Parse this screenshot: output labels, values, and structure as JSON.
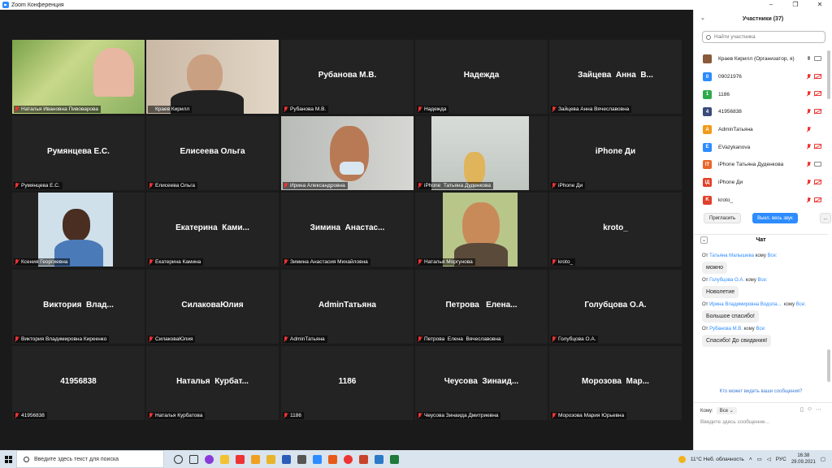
{
  "window": {
    "title": "Zoom Конференция"
  },
  "tiles": [
    {
      "big": "",
      "name": "Наталья Ивановна Пивоварова",
      "photo": "woman-glasses",
      "muted": true
    },
    {
      "big": "",
      "name": "Краев Кирилл",
      "photo": "man-office",
      "active": true,
      "muted": false
    },
    {
      "big": "Рубанова М.В.",
      "name": "Рубанова М.В.",
      "muted": true
    },
    {
      "big": "Надежда",
      "name": "Надежда",
      "muted": true
    },
    {
      "big": "Зайцева  Анна  В...",
      "name": "Зайцева Анна Вячеславовна",
      "muted": true
    },
    {
      "big": "Румянцева Е.С.",
      "name": "Румянцева Е.С.",
      "muted": true
    },
    {
      "big": "Елисеева Ольга",
      "name": "Елисеева Ольга",
      "muted": true
    },
    {
      "big": "",
      "name": "Ирина Александровна",
      "photo": "woman-mask",
      "muted": true
    },
    {
      "big": "",
      "name": "iPhone  Татьяна Дуденкова",
      "photo": "room",
      "muted": true
    },
    {
      "big": "iPhone Ди",
      "name": "iPhone Ди",
      "muted": true
    },
    {
      "big": "",
      "name": "Ксения Георгиевна",
      "photo": "woman-blue",
      "muted": true
    },
    {
      "big": "Екатерина  Ками...",
      "name": "Екатерина Камина",
      "muted": true
    },
    {
      "big": "Зимина  Анастас...",
      "name": "Зимина Анастасия Михайловна",
      "muted": true
    },
    {
      "big": "",
      "name": "Наталья Моргунова",
      "photo": "woman-portrait",
      "muted": true
    },
    {
      "big": "kroto_",
      "name": "kroto_",
      "muted": true
    },
    {
      "big": "Виктория  Влад...",
      "name": "Виктория Владимировна Киреенко",
      "muted": true
    },
    {
      "big": "СилаковаЮлия",
      "name": "СилаковаЮлия",
      "muted": true
    },
    {
      "big": "AdminТатьяна",
      "name": "AdminТатьяна",
      "muted": true
    },
    {
      "big": "Петрова   Елена...",
      "name": "Петрова  Елена  Вячеславовна",
      "muted": true
    },
    {
      "big": "Голубцова О.А.",
      "name": "Голубцова О.А.",
      "muted": true
    },
    {
      "big": "41956838",
      "name": "41956838",
      "muted": true
    },
    {
      "big": "Наталья  Курбат...",
      "name": "Наталья Курбатова",
      "muted": true
    },
    {
      "big": "1186",
      "name": "1186",
      "muted": true
    },
    {
      "big": "Чеусова  Зинаид...",
      "name": "Чеусова Зинаида Дмитриевна",
      "muted": true
    },
    {
      "big": "Морозова  Мар...",
      "name": "Морозова Мария Юрьевна",
      "muted": true
    }
  ],
  "participants_panel": {
    "title": "Участники (37)",
    "search_placeholder": "Найти участника",
    "rows": [
      {
        "avatar": "",
        "avatar_color": "#8a5a3a",
        "name": "Краев Кирилл (Организатор, я)",
        "mic_on": true,
        "cam_on": true
      },
      {
        "avatar": "0",
        "avatar_color": "#2D8CFF",
        "name": "09021976",
        "mic_on": false,
        "cam_on": false
      },
      {
        "avatar": "1",
        "avatar_color": "#2eaa4c",
        "name": "1186",
        "mic_on": false,
        "cam_on": false
      },
      {
        "avatar": "4",
        "avatar_color": "#3a4a7a",
        "name": "41956838",
        "mic_on": false,
        "cam_on": false
      },
      {
        "avatar": "A",
        "avatar_color": "#f09a1a",
        "name": "AdminТатьяна",
        "mic_on": false,
        "cam_on": null
      },
      {
        "avatar": "E",
        "avatar_color": "#2D8CFF",
        "name": "EVazykanova",
        "mic_on": false,
        "cam_on": false
      },
      {
        "avatar": "IT",
        "avatar_color": "#e8672a",
        "name": "iPhone  Татьяна Дуденкова",
        "mic_on": false,
        "cam_on": true
      },
      {
        "avatar": "IД",
        "avatar_color": "#e0402a",
        "name": "iPhone Ди",
        "mic_on": false,
        "cam_on": false
      },
      {
        "avatar": "K",
        "avatar_color": "#e0402a",
        "name": "kroto_",
        "mic_on": false,
        "cam_on": false
      }
    ],
    "invite_label": "Пригласить",
    "mute_all_label": "Выкл. весь звук",
    "more_label": "..."
  },
  "chat": {
    "title": "Чат",
    "messages": [
      {
        "from_prefix": "От ",
        "from": "Татьяна Малышева",
        "to_prefix": " кому ",
        "to": "Все:",
        "text": "можно"
      },
      {
        "from_prefix": "От ",
        "from": "Голубцова О.А.",
        "to_prefix": " кому ",
        "to": "Все:",
        "text": "Новолетие"
      },
      {
        "from_prefix": "От ",
        "from": "Ирина Владимировна Водола...",
        "to_prefix": "  кому ",
        "to": "Все:",
        "text": "Большое спасибо!"
      },
      {
        "from_prefix": "От ",
        "from": "Рубанова М.В.",
        "to_prefix": " кому ",
        "to": "Все:",
        "text": "Спасибо! До свидания!"
      }
    ],
    "who_sees": "Кто может видеть ваши сообщения?",
    "to_label": "Кому:",
    "to_value": "Все",
    "input_placeholder": "Введите здесь сообщение..."
  },
  "taskbar": {
    "search_placeholder": "Введите здесь текст для поиска",
    "weather": "11°C  Неб. облачность",
    "lang": "РУС",
    "time": "16:38",
    "date": "29.09.2021"
  }
}
